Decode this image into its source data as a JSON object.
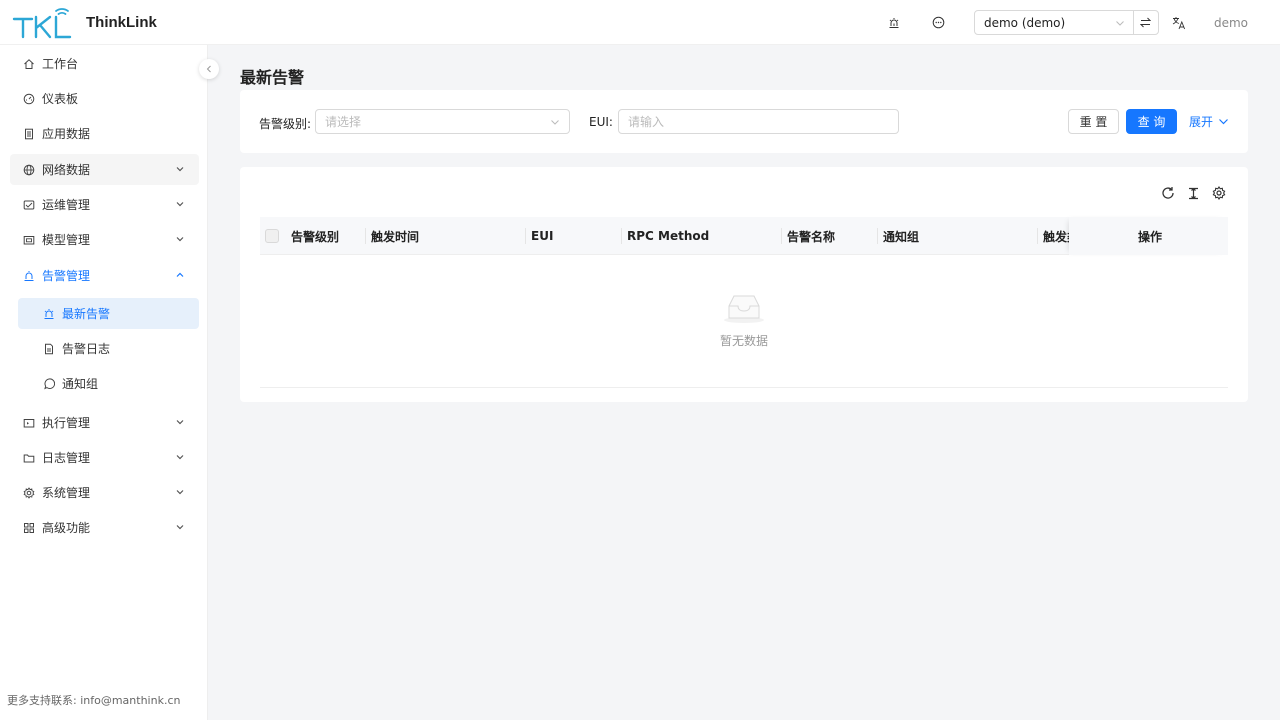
{
  "header": {
    "brand": "ThinkLink",
    "logo_text": "TKL",
    "tenant": "demo (demo)",
    "user": "demo",
    "icons": [
      "alarm-icon",
      "chat-icon",
      "swap-icon",
      "translate-icon"
    ]
  },
  "sidebar": {
    "items": [
      {
        "label": "工作台",
        "icon": "home-icon"
      },
      {
        "label": "仪表板",
        "icon": "dashboard-icon"
      },
      {
        "label": "应用数据",
        "icon": "file-icon"
      },
      {
        "label": "网络数据",
        "icon": "globe-icon"
      },
      {
        "label": "运维管理",
        "icon": "ops-icon"
      },
      {
        "label": "模型管理",
        "icon": "model-icon"
      },
      {
        "label": "告警管理",
        "icon": "alarm-icon"
      },
      {
        "label": "执行管理",
        "icon": "exec-icon"
      },
      {
        "label": "日志管理",
        "icon": "folder-icon"
      },
      {
        "label": "系统管理",
        "icon": "gear-icon"
      },
      {
        "label": "高级功能",
        "icon": "grid-icon"
      }
    ],
    "alarm_submenu": [
      {
        "label": "最新告警",
        "icon": "alarm-icon"
      },
      {
        "label": "告警日志",
        "icon": "doc-icon"
      },
      {
        "label": "通知组",
        "icon": "whatsapp-icon"
      }
    ],
    "support": "更多支持联系: info@manthink.cn"
  },
  "page": {
    "title": "最新告警"
  },
  "search": {
    "level_label": "告警级别:",
    "level_placeholder": "请选择",
    "eui_label": "EUI:",
    "eui_placeholder": "请输入",
    "reset": "重 置",
    "query": "查 询",
    "expand": "展开"
  },
  "table": {
    "columns": [
      "告警级别",
      "触发时间",
      "EUI",
      "RPC Method",
      "告警名称",
      "通知组",
      "触发类型",
      "操作"
    ],
    "empty_text": "暂无数据",
    "tools": [
      "refresh-icon",
      "column-height-icon",
      "settings-icon"
    ]
  },
  "colors": {
    "primary": "#1677ff",
    "logo": "#2ca7d6",
    "selected_bg": "#e6f0fb"
  }
}
